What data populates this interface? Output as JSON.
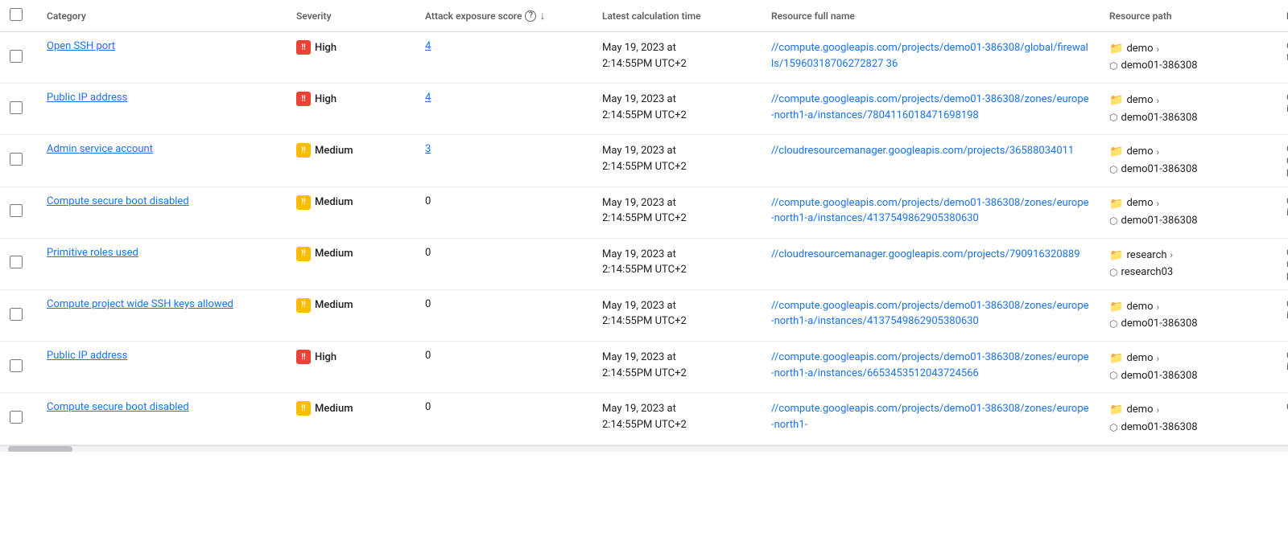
{
  "table": {
    "headers": {
      "checkbox": "",
      "category": "Category",
      "severity": "Severity",
      "attack_score": "Attack exposure score",
      "latest_time": "Latest calculation time",
      "resource_name": "Resource full name",
      "resource_path": "Resource path",
      "re": "Re"
    },
    "rows": [
      {
        "id": "row1",
        "category": "Open SSH port",
        "severity_level": "High",
        "severity_type": "high",
        "attack_score": "4",
        "time_line1": "May 19, 2023 at",
        "time_line2": "2:14:55PM UTC+2",
        "resource_name": "//compute.googleapis.com/projects/demo01-386308/global/firewalls/15960318706272827 36",
        "resource_path_folder": "demo",
        "resource_path_project": "demo01-386308",
        "re_text": "G... fir..."
      },
      {
        "id": "row2",
        "category": "Public IP address",
        "severity_level": "High",
        "severity_type": "high",
        "attack_score": "4",
        "time_line1": "May 19, 2023 at",
        "time_line2": "2:14:55PM UTC+2",
        "resource_name": "//compute.googleapis.com/projects/demo01-386308/zones/europe-north1-a/instances/7804116018471698198",
        "resource_path_folder": "demo",
        "resource_path_project": "demo01-386308",
        "re_text": "G... in..."
      },
      {
        "id": "row3",
        "category": "Admin service account",
        "severity_level": "Medium",
        "severity_type": "medium",
        "attack_score": "3",
        "time_line1": "May 19, 2023 at",
        "time_line2": "2:14:55PM UTC+2",
        "resource_name": "//cloudresourcemanager.googleapis.com/projects/36588034011",
        "resource_path_folder": "demo",
        "resource_path_project": "demo01-386308",
        "re_text": "G... re... pr..."
      },
      {
        "id": "row4",
        "category": "Compute secure boot disabled",
        "severity_level": "Medium",
        "severity_type": "medium",
        "attack_score": "0",
        "time_line1": "May 19, 2023 at",
        "time_line2": "2:14:55PM UTC+2",
        "resource_name": "//compute.googleapis.com/projects/demo01-386308/zones/europe-north1-a/instances/4137549862905380630",
        "resource_path_folder": "demo",
        "resource_path_project": "demo01-386308",
        "re_text": "G... in..."
      },
      {
        "id": "row5",
        "category": "Primitive roles used",
        "severity_level": "Medium",
        "severity_type": "medium",
        "attack_score": "0",
        "time_line1": "May 19, 2023 at",
        "time_line2": "2:14:55PM UTC+2",
        "resource_name": "//cloudresourcemanager.googleapis.com/projects/790916320889",
        "resource_path_folder": "research",
        "resource_path_project": "research03",
        "re_text": "G... re... pr..."
      },
      {
        "id": "row6",
        "category": "Compute project wide SSH keys allowed",
        "severity_level": "Medium",
        "severity_type": "medium",
        "attack_score": "0",
        "time_line1": "May 19, 2023 at",
        "time_line2": "2:14:55PM UTC+2",
        "resource_name": "//compute.googleapis.com/projects/demo01-386308/zones/europe-north1-a/instances/4137549862905380630",
        "resource_path_folder": "demo",
        "resource_path_project": "demo01-386308",
        "re_text": "G... in..."
      },
      {
        "id": "row7",
        "category": "Public IP address",
        "severity_level": "High",
        "severity_type": "high",
        "attack_score": "0",
        "time_line1": "May 19, 2023 at",
        "time_line2": "2:14:55PM UTC+2",
        "resource_name": "//compute.googleapis.com/projects/demo01-386308/zones/europe-north1-a/instances/6653453512043724566",
        "resource_path_folder": "demo",
        "resource_path_project": "demo01-386308",
        "re_text": "G... in..."
      },
      {
        "id": "row8",
        "category": "Compute secure boot disabled",
        "severity_level": "Medium",
        "severity_type": "medium",
        "attack_score": "0",
        "time_line1": "May 19, 2023 at",
        "time_line2": "2:14:55PM UTC+2",
        "resource_name": "//compute.googleapis.com/projects/demo01-386308/zones/europe-north1-",
        "resource_path_folder": "demo",
        "resource_path_project": "demo01-386308",
        "re_text": "G..."
      }
    ]
  }
}
